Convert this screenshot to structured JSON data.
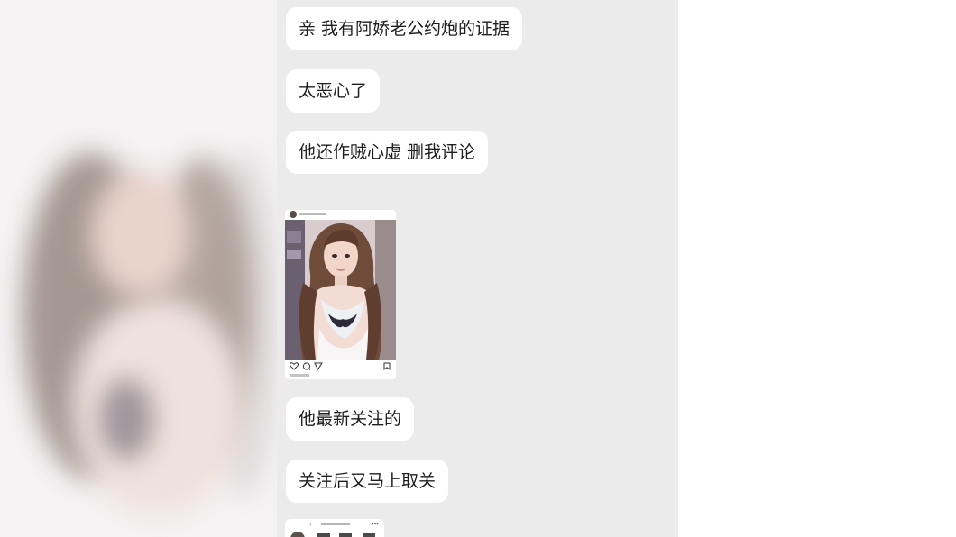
{
  "messages": [
    {
      "text": "亲 我有阿娇老公约炮的证据"
    },
    {
      "text": "太恶心了"
    },
    {
      "text": "他还作贼心虚 删我评论"
    },
    {
      "text": "他最新关注的"
    },
    {
      "text": "关注后又马上取关"
    }
  ],
  "colors": {
    "chat_background": "#ebebeb",
    "bubble": "#ffffff",
    "text": "#1e1e1e"
  },
  "icons": [
    "heart-icon",
    "comment-icon",
    "send-icon",
    "bookmark-icon",
    "back-icon",
    "more-icon"
  ]
}
